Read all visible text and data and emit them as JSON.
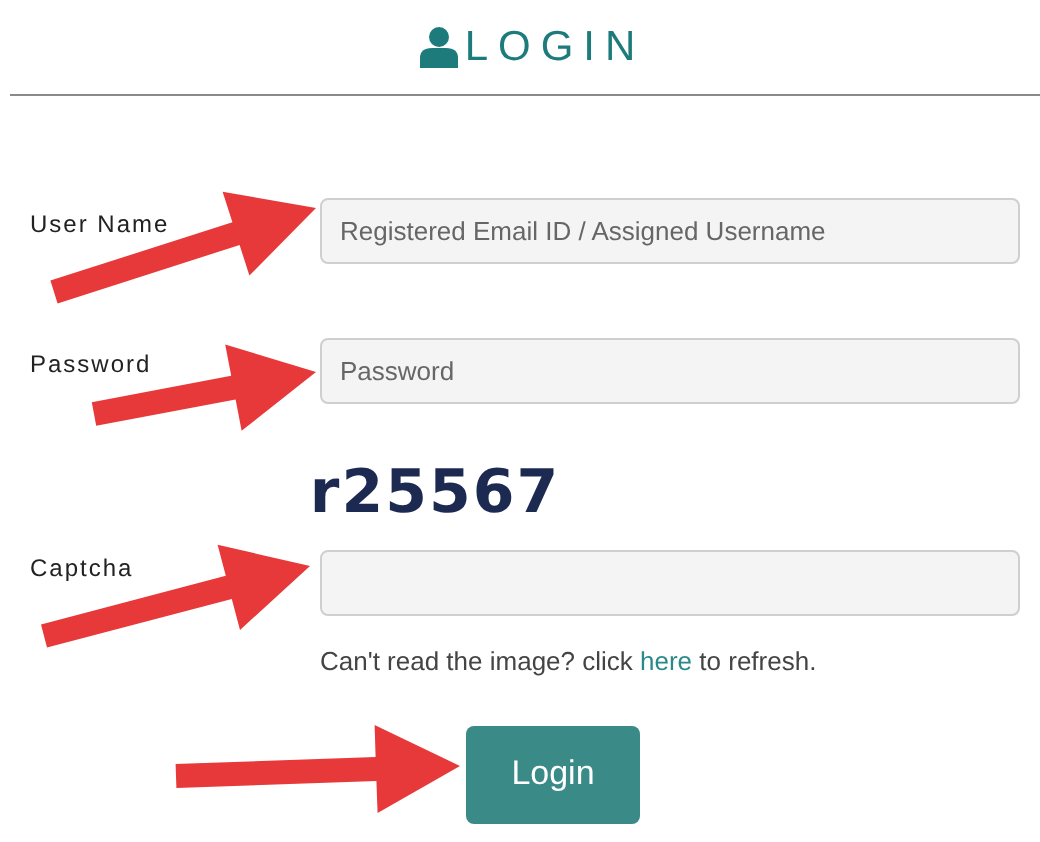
{
  "header": {
    "title": "LOGIN"
  },
  "fields": [
    {
      "label": "User Name",
      "kind": "text",
      "placeholder": "Registered Email ID / Assigned Username"
    },
    {
      "label": "Password",
      "kind": "password",
      "placeholder": "Password"
    },
    {
      "label": "Captcha",
      "kind": "captcha",
      "captcha": "r25567",
      "help_before": "Can't read the image? click",
      "help_link": "here",
      "help_after": "to refresh."
    }
  ],
  "button": "Login"
}
